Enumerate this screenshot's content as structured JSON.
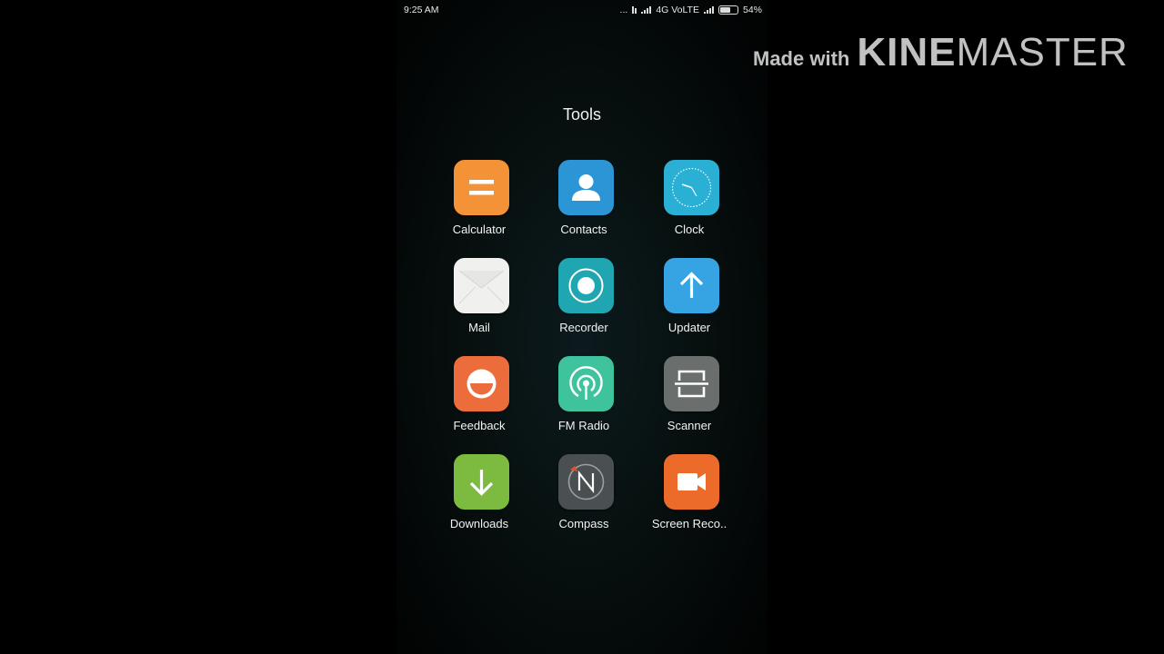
{
  "status_bar": {
    "time": "9:25 AM",
    "dots": "...",
    "network": "4G VoLTE",
    "battery_text": "54%",
    "battery_level": 0.54
  },
  "watermark": {
    "made_with": "Made with",
    "brand_bold": "KINE",
    "brand_light": "MASTER"
  },
  "folder": {
    "title": "Tools",
    "apps": [
      {
        "label": "Calculator",
        "icon": "calculator-icon",
        "color": "#f39236"
      },
      {
        "label": "Contacts",
        "icon": "contacts-icon",
        "color": "#2b95d6"
      },
      {
        "label": "Clock",
        "icon": "clock-icon",
        "color": "#2ab0d4"
      },
      {
        "label": "Mail",
        "icon": "mail-icon",
        "color": "#f0f0ee"
      },
      {
        "label": "Recorder",
        "icon": "recorder-icon",
        "color": "#1fa6b0"
      },
      {
        "label": "Updater",
        "icon": "updater-icon",
        "color": "#36a3e2"
      },
      {
        "label": "Feedback",
        "icon": "feedback-icon",
        "color": "#ec6c3c"
      },
      {
        "label": "FM Radio",
        "icon": "fm-radio-icon",
        "color": "#3fc29e"
      },
      {
        "label": "Scanner",
        "icon": "scanner-icon",
        "color": "#6a6e6c"
      },
      {
        "label": "Downloads",
        "icon": "downloads-icon",
        "color": "#7cbb3f"
      },
      {
        "label": "Compass",
        "icon": "compass-icon",
        "color": "#4a4f52"
      },
      {
        "label": "Screen Reco..",
        "icon": "screen-recorder-icon",
        "color": "#ec6a2a"
      }
    ]
  }
}
